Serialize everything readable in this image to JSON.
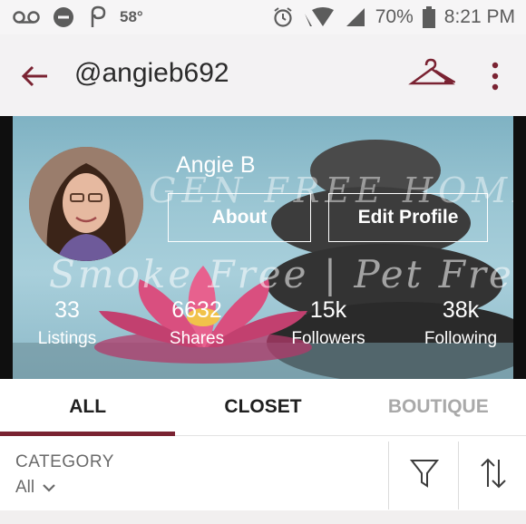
{
  "status_bar": {
    "temperature": "58°",
    "battery_pct": "70%",
    "time": "8:21 PM",
    "icons": [
      "voicemail-icon",
      "do-not-disturb-icon",
      "poshmark-p-icon",
      "alarm-icon",
      "wifi-icon",
      "signal-icon",
      "battery-icon"
    ]
  },
  "header": {
    "username": "@angieb692",
    "icons": [
      "back-arrow-icon",
      "hanger-icon",
      "more-vertical-icon"
    ],
    "accent_color": "#7a2332"
  },
  "profile": {
    "display_name": "Angie B",
    "about_label": "About",
    "edit_profile_label": "Edit Profile",
    "banner_text_line1": "GEN FREE HOME",
    "banner_text_line2": "Smoke Free | Pet Free",
    "stats": [
      {
        "value": "33",
        "label": "Listings"
      },
      {
        "value": "6632",
        "label": "Shares"
      },
      {
        "value": "15k",
        "label": "Followers"
      },
      {
        "value": "38k",
        "label": "Following"
      }
    ]
  },
  "tabs": [
    {
      "label": "ALL",
      "active": true
    },
    {
      "label": "CLOSET",
      "active": false
    },
    {
      "label": "BOUTIQUE",
      "active": false
    }
  ],
  "filter": {
    "category_label": "CATEGORY",
    "category_value": "All",
    "icons": [
      "chevron-down-icon",
      "filter-funnel-icon",
      "sort-arrows-icon"
    ]
  }
}
